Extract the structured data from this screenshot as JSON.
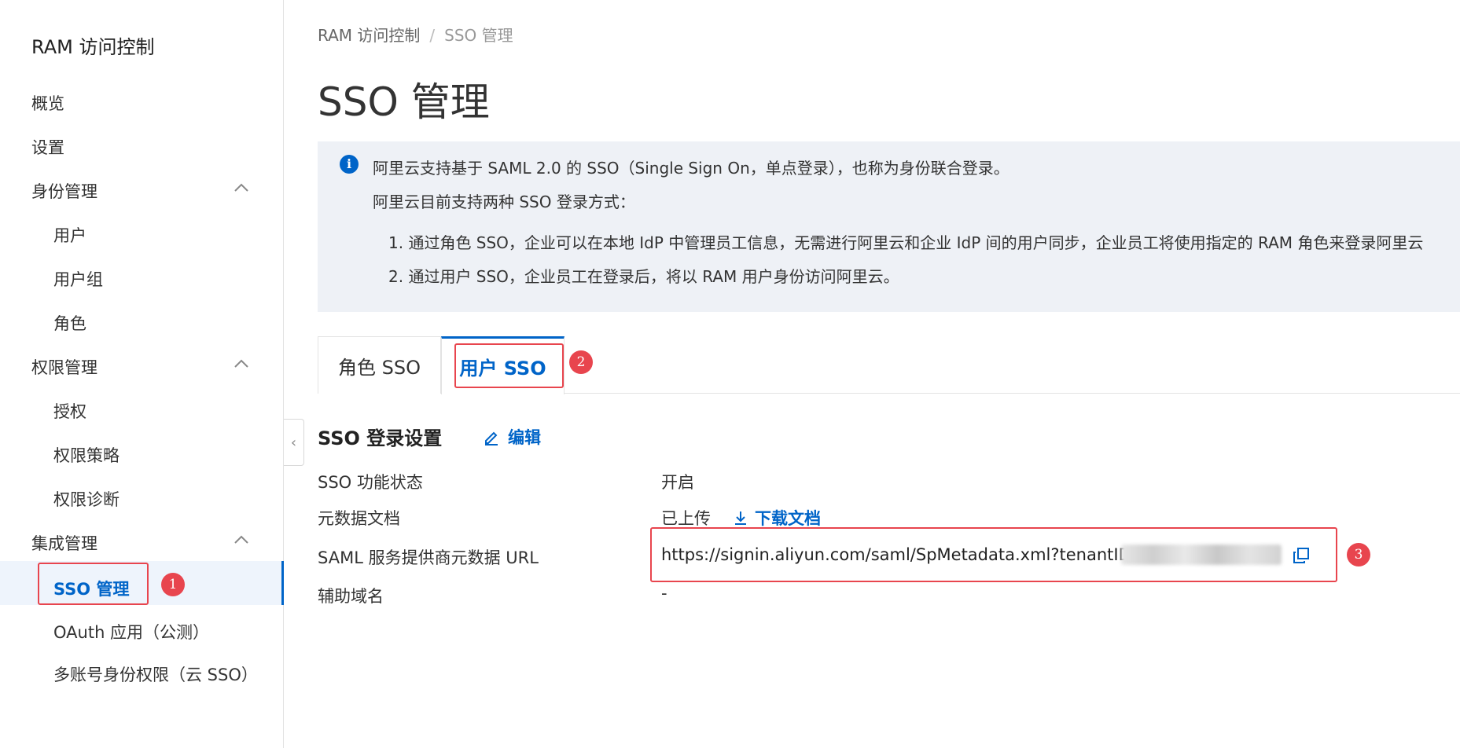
{
  "sidebar": {
    "title": "RAM 访问控制",
    "items": [
      {
        "label": "概览"
      },
      {
        "label": "设置"
      },
      {
        "label": "身份管理"
      },
      {
        "label": "用户"
      },
      {
        "label": "用户组"
      },
      {
        "label": "角色"
      },
      {
        "label": "权限管理"
      },
      {
        "label": "授权"
      },
      {
        "label": "权限策略"
      },
      {
        "label": "权限诊断"
      },
      {
        "label": "集成管理"
      },
      {
        "label": "SSO 管理"
      },
      {
        "label": "OAuth 应用（公测）"
      },
      {
        "label": "多账号身份权限（云 SSO）"
      }
    ]
  },
  "callouts": [
    "1",
    "2",
    "3"
  ],
  "breadcrumb": {
    "root": "RAM 访问控制",
    "sep": "/",
    "current": "SSO 管理"
  },
  "page_title": "SSO 管理",
  "info": {
    "line1": "阿里云支持基于 SAML 2.0 的 SSO（Single Sign On，单点登录），也称为身份联合登录。",
    "line2": "阿里云目前支持两种 SSO 登录方式：",
    "line3": "1. 通过角色 SSO，企业可以在本地 IdP 中管理员工信息，无需进行阿里云和企业 IdP 间的用户同步，企业员工将使用指定的 RAM 角色来登录阿里云",
    "line4": "2. 通过用户 SSO，企业员工在登录后，将以 RAM 用户身份访问阿里云。"
  },
  "tabs": [
    {
      "label": "角色 SSO"
    },
    {
      "label": "用户 SSO"
    }
  ],
  "settings": {
    "title": "SSO 登录设置",
    "edit_label": "编辑",
    "rows": [
      {
        "label": "SSO 功能状态",
        "value": "开启"
      },
      {
        "label": "元数据文档",
        "value": "已上传",
        "link": "下载文档"
      },
      {
        "label": "SAML 服务提供商元数据 URL",
        "value": "https://signin.aliyun.com/saml/SpMetadata.xml?tenantID=1"
      },
      {
        "label": "辅助域名",
        "value": "-"
      }
    ]
  },
  "colors": {
    "accent": "#0064c8",
    "highlight": "#e8454e"
  }
}
